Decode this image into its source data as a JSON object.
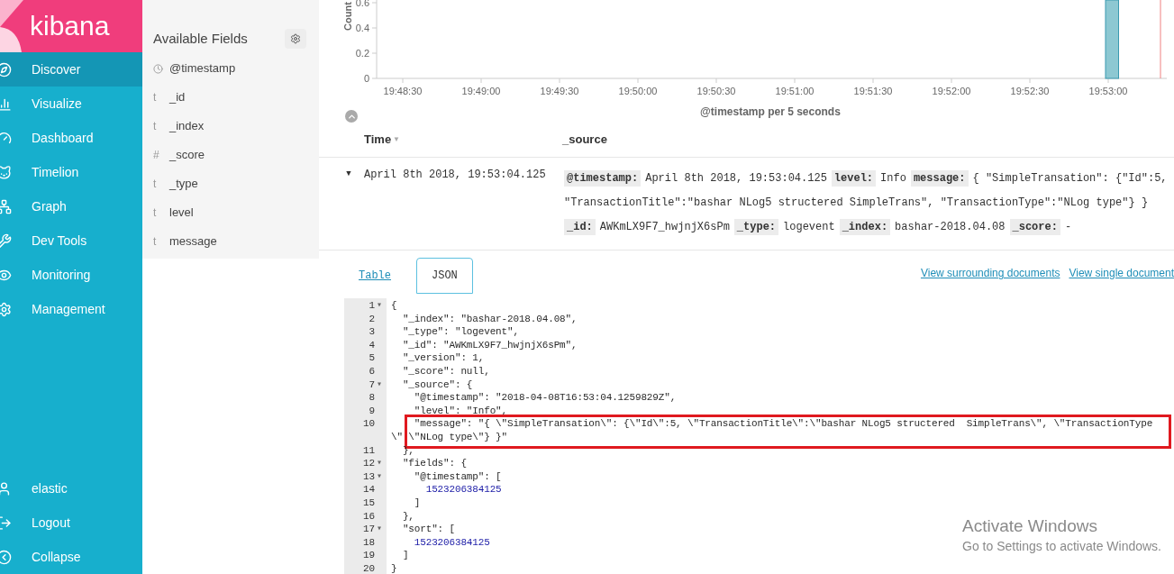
{
  "sidebar": {
    "logo": "kibana",
    "items": [
      {
        "label": "Discover",
        "selected": true
      },
      {
        "label": "Visualize",
        "selected": false
      },
      {
        "label": "Dashboard",
        "selected": false
      },
      {
        "label": "Timelion",
        "selected": false
      },
      {
        "label": "Graph",
        "selected": false
      },
      {
        "label": "Dev Tools",
        "selected": false
      },
      {
        "label": "Monitoring",
        "selected": false
      },
      {
        "label": "Management",
        "selected": false
      }
    ],
    "bottom_items": [
      {
        "label": "elastic"
      },
      {
        "label": "Logout"
      },
      {
        "label": "Collapse"
      }
    ]
  },
  "fields_panel": {
    "title": "Available Fields",
    "fields": [
      {
        "kind": "date",
        "name": "@timestamp"
      },
      {
        "kind": "text",
        "type_label": "t",
        "name": "_id"
      },
      {
        "kind": "text",
        "type_label": "t",
        "name": "_index"
      },
      {
        "kind": "text",
        "type_label": "#",
        "name": "_score"
      },
      {
        "kind": "text",
        "type_label": "t",
        "name": "_type"
      },
      {
        "kind": "text",
        "type_label": "t",
        "name": "level"
      },
      {
        "kind": "text",
        "type_label": "t",
        "name": "message"
      }
    ]
  },
  "histogram": {
    "ylabel": "Count",
    "xlabel": "@timestamp per 5 seconds",
    "yticks": [
      "0.6",
      "0.4",
      "0.2",
      "0"
    ],
    "xticks": [
      "19:48:30",
      "19:49:00",
      "19:49:30",
      "19:50:00",
      "19:50:30",
      "19:51:00",
      "19:51:30",
      "19:52:00",
      "19:52:30",
      "19:53:00"
    ]
  },
  "table": {
    "columns": [
      {
        "label": "Time",
        "sort_marker": "▼"
      },
      {
        "label": "_source"
      }
    ],
    "row": {
      "toggle": "▼",
      "time": "April 8th 2018, 19:53:04.125",
      "source_lines": [
        [
          {
            "kind": "key",
            "text": "@timestamp:"
          },
          {
            "kind": "value",
            "text": "April 8th 2018, 19:53:04.125"
          },
          {
            "kind": "key",
            "text": "level:"
          },
          {
            "kind": "value",
            "text": "Info"
          },
          {
            "kind": "key",
            "text": "message:"
          },
          {
            "kind": "value",
            "text": "{ \"SimpleTransation\": {\"Id\":5,"
          }
        ],
        [
          {
            "kind": "value",
            "text": "\"TransactionTitle\":\"bashar NLog5 structered SimpleTrans\", \"TransactionType\":\"NLog type\"} }"
          }
        ],
        [
          {
            "kind": "key",
            "text": "_id:"
          },
          {
            "kind": "value",
            "text": "AWKmLX9F7_hwjnjX6sPm"
          },
          {
            "kind": "key",
            "text": "_type:"
          },
          {
            "kind": "value",
            "text": "logevent"
          },
          {
            "kind": "key",
            "text": "_index:"
          },
          {
            "kind": "value",
            "text": "bashar-2018.04.08"
          },
          {
            "kind": "key",
            "text": "_score:"
          },
          {
            "kind": "value",
            "text": "-"
          }
        ]
      ]
    }
  },
  "doc_tabs": [
    {
      "label": "Table",
      "selected": false
    },
    {
      "label": "JSON",
      "selected": true
    }
  ],
  "doc_links": [
    "View surrounding documents",
    "View single document"
  ],
  "json_lines": [
    {
      "num": "1",
      "fold_marker": "▾",
      "text": "{",
      "highlighted": false
    },
    {
      "num": "2",
      "text": "  \"_index\": \"bashar-2018.04.08\",",
      "highlighted": false
    },
    {
      "num": "3",
      "text": "  \"_type\": \"logevent\",",
      "highlighted": false
    },
    {
      "num": "4",
      "text": "  \"_id\": \"AWKmLX9F7_hwjnjX6sPm\",",
      "highlighted": false
    },
    {
      "num": "5",
      "text": "  \"_version\": 1,",
      "highlighted": false
    },
    {
      "num": "6",
      "text": "  \"_score\": null,",
      "highlighted": false
    },
    {
      "num": "7",
      "fold_marker": "▾",
      "text": "  \"_source\": {",
      "highlighted": false
    },
    {
      "num": "8",
      "text": "    \"@timestamp\": \"2018-04-08T16:53:04.1259829Z\",",
      "highlighted": false
    },
    {
      "num": "9",
      "text": "    \"level\": \"Info\",",
      "highlighted": false
    },
    {
      "num": "10",
      "text": "    \"message\": \"{ \\\"SimpleTransation\\\": {\\\"Id\\\":5, \\\"TransactionTitle\\\":\\\"bashar NLog5 structered  SimpleTrans\\\", \\\"TransactionType",
      "continuation": "\\\" \\\"NLog type\\\"} }\"",
      "highlighted": true
    },
    {
      "num": "11",
      "text": "  },",
      "highlighted": false
    },
    {
      "num": "12",
      "fold_marker": "▾",
      "text": "  \"fields\": {",
      "highlighted": false
    },
    {
      "num": "13",
      "fold_marker": "▾",
      "text": "    \"@timestamp\": [",
      "highlighted": false
    },
    {
      "num": "14",
      "text": "      1523206384125",
      "kind": "number",
      "highlighted": false
    },
    {
      "num": "15",
      "text": "    ]",
      "highlighted": false
    },
    {
      "num": "16",
      "text": "  },",
      "highlighted": false
    },
    {
      "num": "17",
      "fold_marker": "▾",
      "text": "  \"sort\": [",
      "highlighted": false
    },
    {
      "num": "18",
      "text": "    1523206384125",
      "kind": "number",
      "highlighted": false
    },
    {
      "num": "19",
      "text": "  ]",
      "highlighted": false
    },
    {
      "num": "20",
      "text": "}",
      "highlighted": false
    }
  ],
  "os_notice": {
    "title": "Activate Windows",
    "subtitle": "Go to Settings to activate Windows."
  }
}
